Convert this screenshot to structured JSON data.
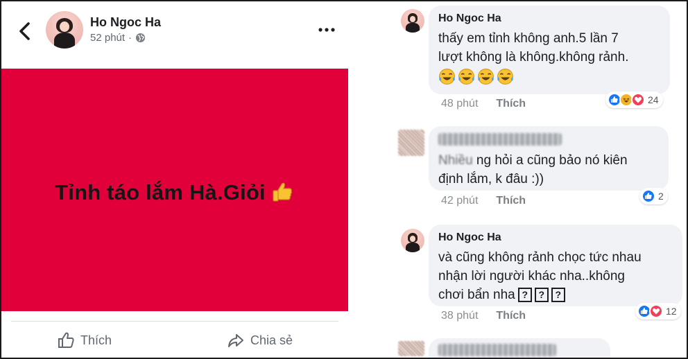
{
  "post": {
    "author": "Ho Ngoc Ha",
    "time": "52 phút",
    "separator": "·",
    "image_text": "Tỉnh táo lắm Hà.Giỏi",
    "image_bg_color": "#e2003b",
    "actions": {
      "like_label": "Thích",
      "share_label": "Chia sẻ"
    }
  },
  "comments": [
    {
      "author": "Ho Ngoc Ha",
      "text": "thấy em tỉnh không anh.5 lần 7\nlượt không là không.không rảnh.",
      "emojis": [
        "laughing-tears-icon",
        "laughing-tears-icon",
        "laughing-tears-icon",
        "laughing-tears-icon"
      ],
      "time": "48 phút",
      "like_label": "Thích",
      "reactions": [
        "like",
        "haha",
        "love"
      ],
      "reaction_count": "24"
    },
    {
      "author": "",
      "text_first": "Nhiều",
      "text_rest": " ng hỏi a cũng bảo nó kiên\nđịnh lắm, k đâu :))",
      "time": "42 phút",
      "like_label": "Thích",
      "reactions": [
        "like"
      ],
      "reaction_count": "2"
    },
    {
      "author": "Ho Ngoc Ha",
      "text": "và cũng không rảnh chọc tức nhau\nnhận lời người khác nha..không\nchơi bẩn nha",
      "box_glyphs": [
        "?",
        "?",
        "?"
      ],
      "time": "38 phút",
      "like_label": "Thích",
      "reactions": [
        "like",
        "love"
      ],
      "reaction_count": "12"
    }
  ],
  "colors": {
    "meta_gray": "#8a8d91",
    "bubble_bg": "#f0f2f5",
    "like_blue": "#1877f2",
    "love_red": "#f33e58",
    "haha_yellow": "#f7b125"
  }
}
